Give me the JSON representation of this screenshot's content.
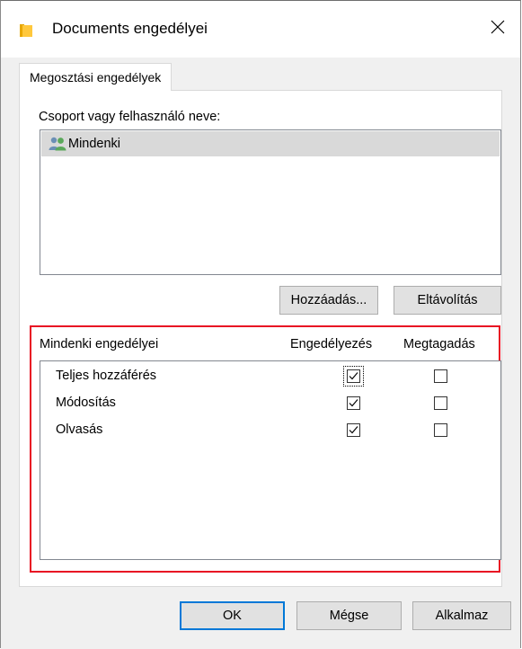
{
  "window": {
    "title": "Documents engedélyei",
    "icon": "folder-icon",
    "close_glyph": "✕"
  },
  "tab": {
    "label": "Megosztási engedélyek"
  },
  "group": {
    "label": "Csoport vagy felhasználó neve:",
    "users": [
      {
        "name": "Mindenki",
        "icon": "users-icon",
        "selected": true
      }
    ]
  },
  "buttons": {
    "add": "Hozzáadás...",
    "remove": "Eltávolítás",
    "ok": "OK",
    "cancel": "Mégse",
    "apply": "Alkalmaz"
  },
  "permissions": {
    "title": "Mindenki engedélyei",
    "allow_header": "Engedélyezés",
    "deny_header": "Megtagadás",
    "rows": [
      {
        "label": "Teljes hozzáférés",
        "allow": true,
        "deny": false,
        "focused": true
      },
      {
        "label": "Módosítás",
        "allow": true,
        "deny": false,
        "focused": false
      },
      {
        "label": "Olvasás",
        "allow": true,
        "deny": false,
        "focused": false
      }
    ]
  },
  "colors": {
    "highlight_frame": "#e81123",
    "default_button_border": "#0078d7",
    "selection_background": "#d9d9d9",
    "dialog_background": "#f0f0f0"
  }
}
